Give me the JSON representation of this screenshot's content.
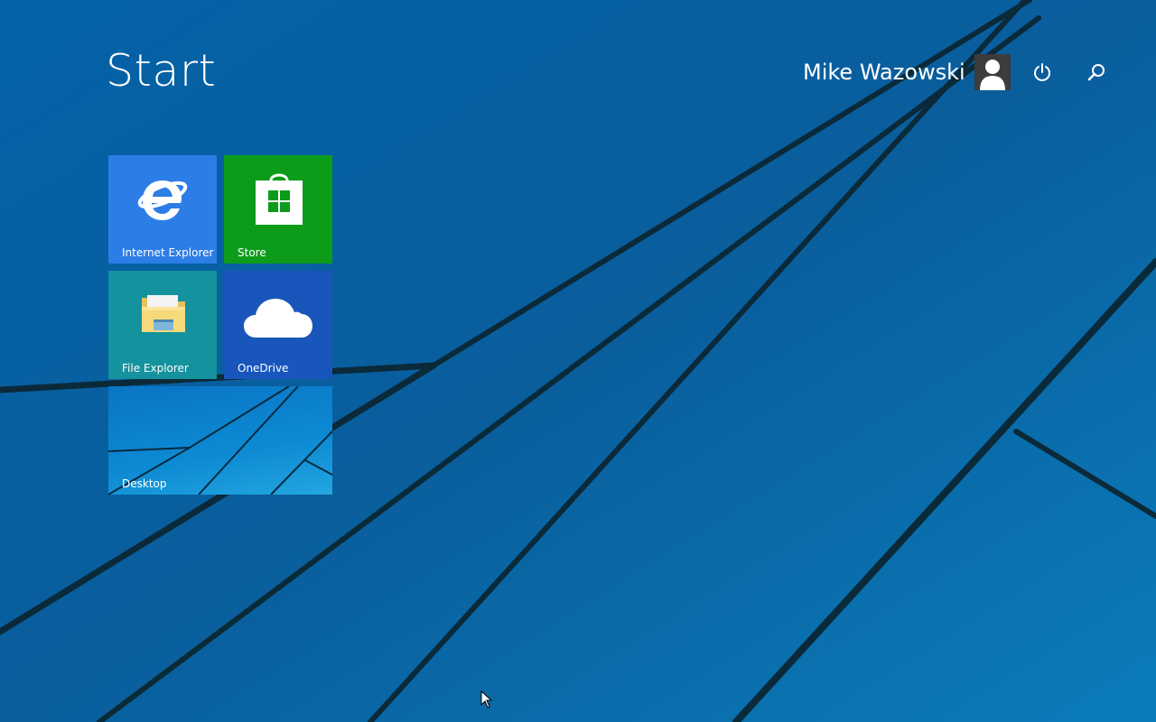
{
  "screen": {
    "title": "Start"
  },
  "user": {
    "name": "Mike Wazowski",
    "avatar_icon": "user-silhouette-icon"
  },
  "header_icons": {
    "power": "power-icon",
    "search": "search-icon"
  },
  "tiles": [
    {
      "label": "Internet Explorer",
      "icon": "internet-explorer-icon",
      "color": "#2d7de7"
    },
    {
      "label": "Store",
      "icon": "store-bag-icon",
      "color": "#0d9c1a"
    },
    {
      "label": "File Explorer",
      "icon": "folder-icon",
      "color": "#14929d"
    },
    {
      "label": "OneDrive",
      "icon": "cloud-icon",
      "color": "#1956bc"
    },
    {
      "label": "Desktop",
      "icon": "desktop-wallpaper-preview",
      "color": "#0a74c4"
    }
  ],
  "colors": {
    "background": "#0a5f9f",
    "text": "#ffffff"
  }
}
